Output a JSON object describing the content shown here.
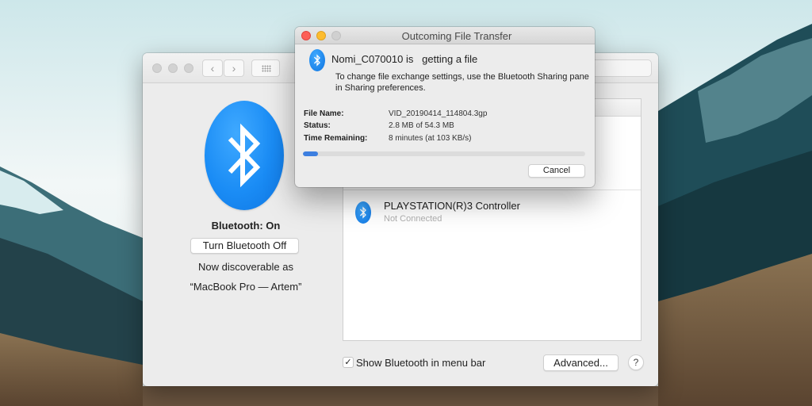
{
  "prefs_window": {
    "status_label": "Bluetooth: On",
    "toggle_button": "Turn Bluetooth Off",
    "discoverable_label": "Now discoverable as",
    "discoverable_name": "“MacBook Pro — Artem”",
    "devices": [
      {
        "name": "PLAYSTATION(R)3 Controller",
        "status": "Not Connected",
        "icon": "bluetooth-icon"
      }
    ],
    "show_in_menu_bar": {
      "label": "Show Bluetooth in menu bar",
      "checked": true,
      "check_glyph": "✓"
    },
    "advanced_button": "Advanced...",
    "help_button": "?",
    "nav_back_glyph": "‹",
    "nav_forward_glyph": "›"
  },
  "dialog": {
    "title": "Outcoming File Transfer",
    "heading": "Nomi_C070010 is   getting a file",
    "message": "To change file exchange settings, use the Bluetooth Sharing pane in Sharing preferences.",
    "fields": [
      {
        "label": "File Name:",
        "value": "VID_20190414_114804.3gp"
      },
      {
        "label": "Status:",
        "value": "2.8 MB of 54.3 MB"
      },
      {
        "label": "Time Remaining:",
        "value": "8 minutes (at 103 KB/s)"
      }
    ],
    "progress_percent": 5.2,
    "cancel_button": "Cancel"
  },
  "colors": {
    "accent": "#3d7fe0",
    "bluetooth_blue": "#1a8cf5",
    "close": "#fc5f57",
    "minimize": "#fdbc2e"
  }
}
